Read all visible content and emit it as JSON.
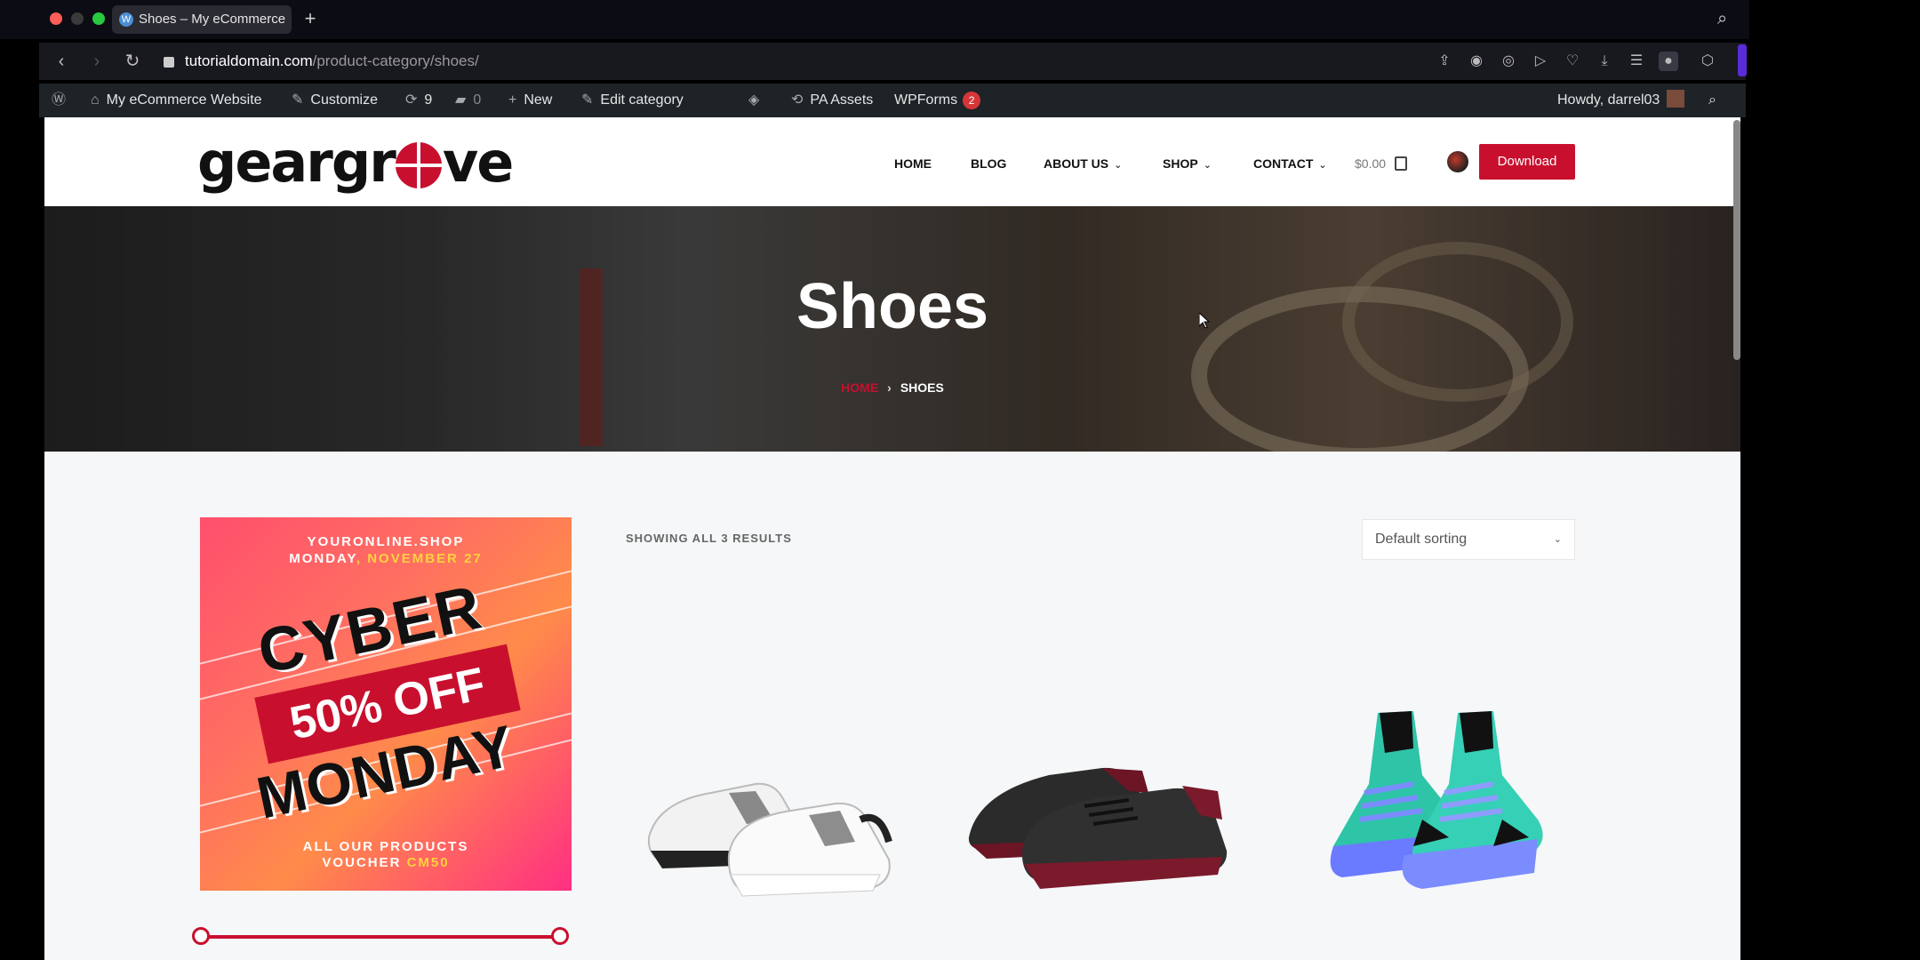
{
  "browser": {
    "tab_title": "Shoes – My eCommerce",
    "url_host": "tutorialdomain.com",
    "url_path": "/product-category/shoes/"
  },
  "adminbar": {
    "site_name": "My eCommerce Website",
    "customize": "Customize",
    "updates_count": "9",
    "comments_count": "0",
    "new": "New",
    "edit_category": "Edit category",
    "pa_assets": "PA Assets",
    "wpforms": "WPForms",
    "wpforms_badge": "2",
    "howdy": "Howdy, darrel03"
  },
  "site": {
    "logo_left": "geargr",
    "logo_right": "ve",
    "nav": {
      "home": "HOME",
      "blog": "BLOG",
      "about": "ABOUT US",
      "shop": "SHOP",
      "contact": "CONTACT"
    },
    "cart_total": "$0.00",
    "download_button": "Download",
    "hero_title": "Shoes",
    "breadcrumb_home": "HOME",
    "breadcrumb_current": "SHOES",
    "results_text": "SHOWING ALL 3 RESULTS",
    "sorting_value": "Default sorting",
    "banner": {
      "line1": "YOURONLINE.SHOP",
      "line2_a": "MONDAY",
      "line2_b": ", NOVEMBER ",
      "line2_c": "27",
      "cyber": "CYBER",
      "off": "50% OFF",
      "monday": "MONDAY",
      "bottom1": "ALL OUR PRODUCTS",
      "bottom2_a": "VOUCHER ",
      "bottom2_b": "CM50"
    }
  },
  "colors": {
    "accent": "#c8102e",
    "admin_bar": "#1d2327"
  }
}
